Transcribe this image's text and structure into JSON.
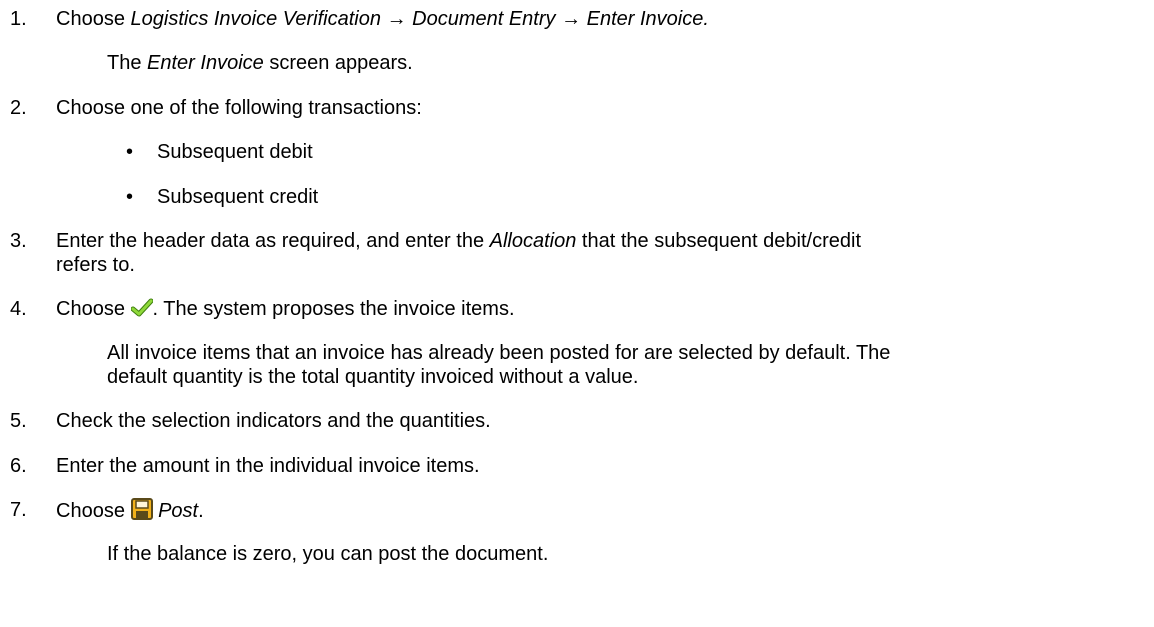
{
  "steps": [
    {
      "number": "1.",
      "prefix": "Choose ",
      "path": [
        "Logistics Invoice Verification",
        "Document Entry",
        "Enter Invoice."
      ],
      "arrow": "→",
      "note_title": "Enter Invoice",
      "note_rest": " screen appears.",
      "note_prefix": "The "
    },
    {
      "number": "2.",
      "text": "Choose one of the following transactions:",
      "bullets": [
        "Subsequent debit",
        "Subsequent credit"
      ],
      "bullet_char": "•"
    },
    {
      "number": "3.",
      "text_a": "Enter the header data as required, and enter the ",
      "emphasis": "Allocation",
      "text_b": " that the subsequent debit/credit",
      "text_c": "refers to."
    },
    {
      "number": "4.",
      "prefix": "Choose ",
      "icon": "green-checkmark-icon",
      "suffix": ". The system proposes the invoice items.",
      "note_1": "All invoice items that an invoice has already been posted for are selected by default. The",
      "note_2": "default quantity is the total quantity invoiced without a value."
    },
    {
      "number": "5.",
      "text": "Check the selection indicators and the quantities."
    },
    {
      "number": "6.",
      "text": "Enter the amount in the individual invoice items."
    },
    {
      "number": "7.",
      "prefix": "Choose ",
      "icon": "save-disk-icon",
      "action": "Post",
      "period": ".",
      "note": "If the balance is zero, you can post the document."
    }
  ],
  "colors": {
    "checkmark": "#6bbf1f",
    "save_icon_body": "#f2b21b",
    "save_icon_outline": "#5a4a1a"
  }
}
